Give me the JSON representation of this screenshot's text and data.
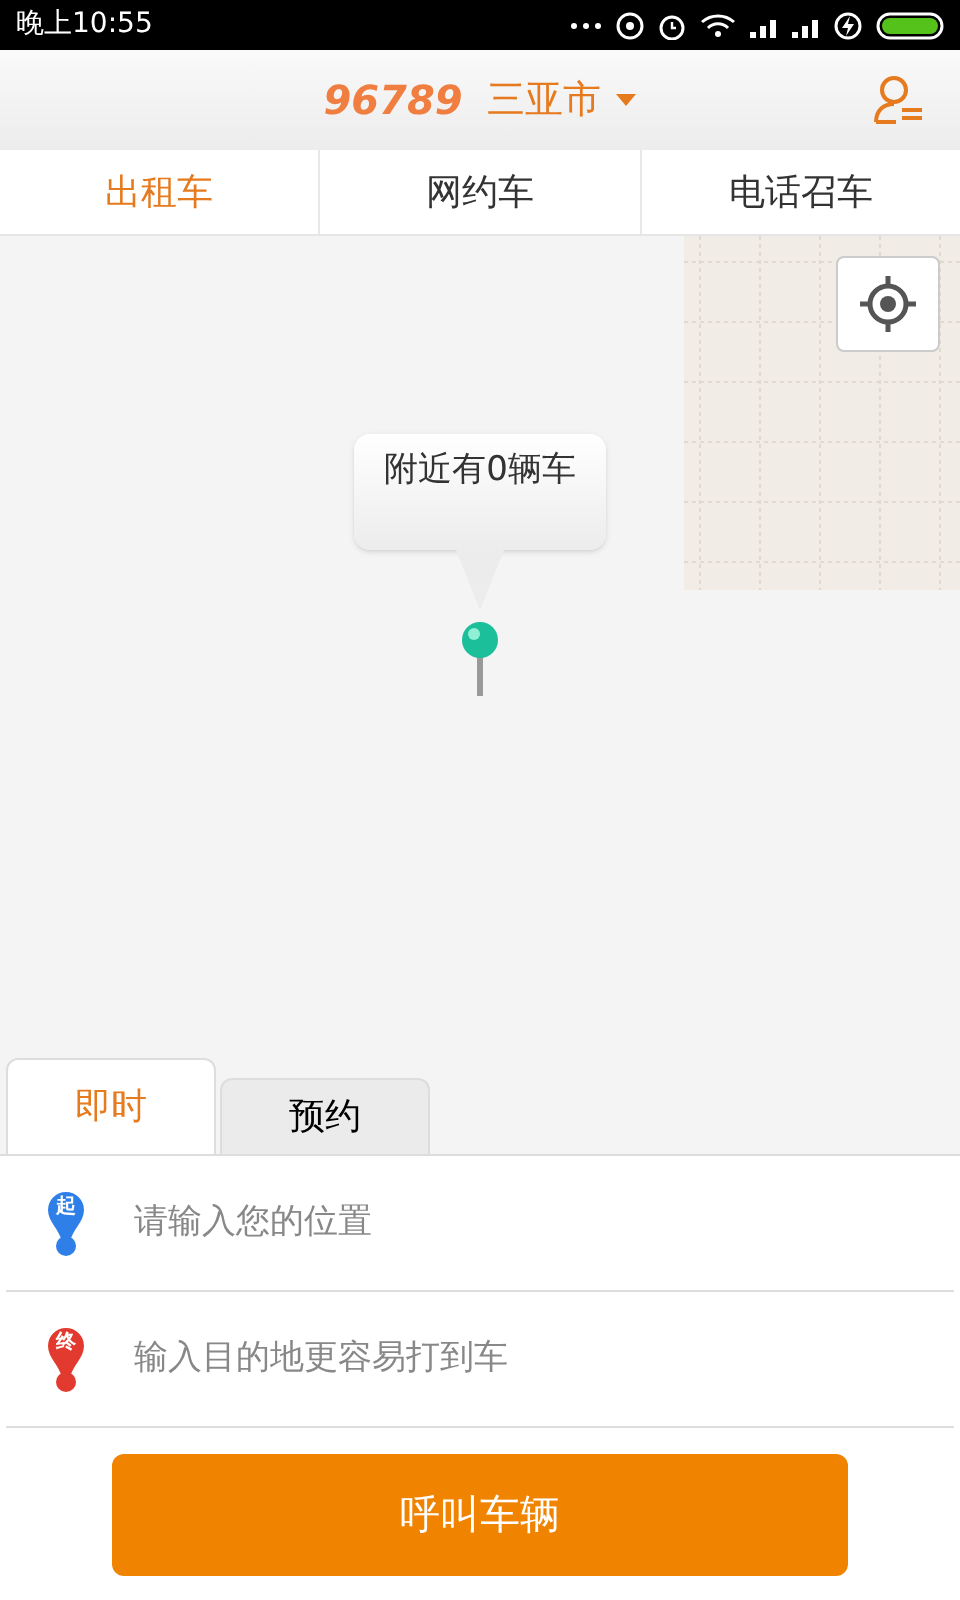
{
  "status_bar": {
    "time": "晚上10:55"
  },
  "header": {
    "logo": "96789",
    "city": "三亚市"
  },
  "service_tabs": [
    {
      "label": "出租车",
      "selected": true
    },
    {
      "label": "网约车",
      "selected": false
    },
    {
      "label": "电话召车",
      "selected": false
    }
  ],
  "map": {
    "bubble": "附近有0辆车"
  },
  "mode_tabs": [
    {
      "label": "即时",
      "selected": true
    },
    {
      "label": "预约",
      "selected": false
    }
  ],
  "inputs": [
    {
      "pin": "起",
      "color": "#2f7fe8",
      "placeholder": "请输入您的位置"
    },
    {
      "pin": "终",
      "color": "#e23a2e",
      "placeholder": "输入目的地更容易打到车"
    }
  ],
  "call_button": "呼叫车辆"
}
